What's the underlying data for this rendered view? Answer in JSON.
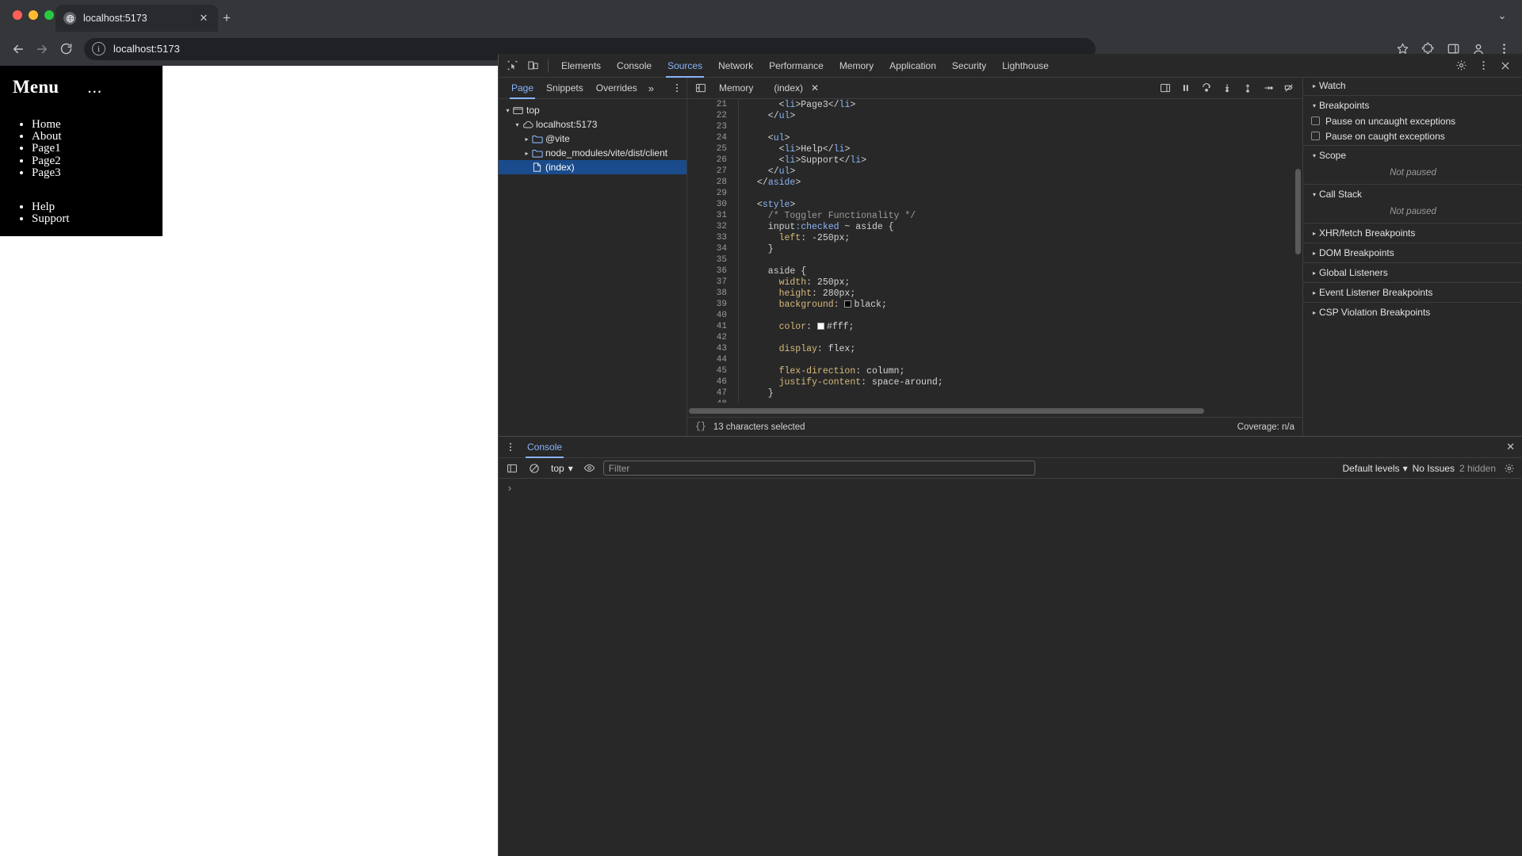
{
  "browser": {
    "tab": {
      "title": "localhost:5173",
      "favicon_icon": "globe-icon",
      "close_icon": "close-icon"
    },
    "new_tab_label": "+",
    "tabstrip_chevron_icon": "chevron-down-icon",
    "nav": {
      "back_icon": "arrow-left-icon",
      "forward_icon": "arrow-right-icon",
      "reload_icon": "reload-icon"
    },
    "omnibox": {
      "info_icon": "info-circle-icon",
      "url": "localhost:5173"
    },
    "actions": {
      "bookmark_icon": "star-icon",
      "extensions_icon": "puzzle-icon",
      "split_icon": "sidebar-icon",
      "profile_icon": "person-icon",
      "menu_icon": "kebab-menu-icon"
    }
  },
  "page": {
    "aside": {
      "title": "Menu",
      "toggle_label": "...",
      "primary_items": [
        "Home",
        "About",
        "Page1",
        "Page2",
        "Page3"
      ],
      "secondary_items": [
        "Help",
        "Support"
      ],
      "background": "#000000",
      "color": "#ffffff"
    }
  },
  "devtools": {
    "toolbar": {
      "inspect_icon": "inspect-element-icon",
      "device_icon": "device-toolbar-icon",
      "tabs": [
        {
          "label": "Elements",
          "active": false
        },
        {
          "label": "Console",
          "active": false
        },
        {
          "label": "Sources",
          "active": true
        },
        {
          "label": "Network",
          "active": false
        },
        {
          "label": "Performance",
          "active": false
        },
        {
          "label": "Memory",
          "active": false
        },
        {
          "label": "Application",
          "active": false
        },
        {
          "label": "Security",
          "active": false
        },
        {
          "label": "Lighthouse",
          "active": false
        }
      ],
      "settings_icon": "gear-icon",
      "more_icon": "kebab-menu-icon",
      "close_icon": "close-icon"
    },
    "navigator": {
      "tabs": [
        {
          "label": "Page",
          "active": true
        },
        {
          "label": "Snippets",
          "active": false
        },
        {
          "label": "Overrides",
          "active": false
        }
      ],
      "more_label": "»",
      "menu_icon": "kebab-menu-icon",
      "tree": [
        {
          "label": "top",
          "icon": "frame-icon",
          "depth": 0,
          "twisty": "▾",
          "selected": false
        },
        {
          "label": "localhost:5173",
          "icon": "cloud-icon",
          "depth": 1,
          "twisty": "▾",
          "selected": false
        },
        {
          "label": "@vite",
          "icon": "folder-icon",
          "depth": 2,
          "twisty": "▸",
          "selected": false
        },
        {
          "label": "node_modules/vite/dist/client",
          "icon": "folder-icon",
          "depth": 2,
          "twisty": "▸",
          "selected": false
        },
        {
          "label": "(index)",
          "icon": "document-icon",
          "depth": 2,
          "twisty": "",
          "selected": true
        }
      ]
    },
    "editor": {
      "sidebar_toggle_icon": "panel-left-icon",
      "memory_tab": "Memory",
      "file_tab": "(index)",
      "file_close_icon": "close-icon",
      "status_left": "13 characters selected",
      "status_right": "Coverage: n/a",
      "brace_icon": "{}",
      "lines": [
        {
          "n": "21",
          "segments": [
            {
              "t": "    <",
              "c": "punc"
            },
            {
              "t": "li",
              "c": "tag"
            },
            {
              "t": ">Page3</",
              "c": "punc"
            },
            {
              "t": "li",
              "c": "tag"
            },
            {
              "t": ">",
              "c": "punc"
            }
          ]
        },
        {
          "n": "22",
          "segments": [
            {
              "t": "  </",
              "c": "punc"
            },
            {
              "t": "ul",
              "c": "tag"
            },
            {
              "t": ">",
              "c": "punc"
            }
          ]
        },
        {
          "n": "23",
          "segments": []
        },
        {
          "n": "24",
          "segments": [
            {
              "t": "  <",
              "c": "punc"
            },
            {
              "t": "ul",
              "c": "tag"
            },
            {
              "t": ">",
              "c": "punc"
            }
          ]
        },
        {
          "n": "25",
          "segments": [
            {
              "t": "    <",
              "c": "punc"
            },
            {
              "t": "li",
              "c": "tag"
            },
            {
              "t": ">Help</",
              "c": "punc"
            },
            {
              "t": "li",
              "c": "tag"
            },
            {
              "t": ">",
              "c": "punc"
            }
          ]
        },
        {
          "n": "26",
          "segments": [
            {
              "t": "    <",
              "c": "punc"
            },
            {
              "t": "li",
              "c": "tag"
            },
            {
              "t": ">Support</",
              "c": "punc"
            },
            {
              "t": "li",
              "c": "tag"
            },
            {
              "t": ">",
              "c": "punc"
            }
          ]
        },
        {
          "n": "27",
          "segments": [
            {
              "t": "  </",
              "c": "punc"
            },
            {
              "t": "ul",
              "c": "tag"
            },
            {
              "t": ">",
              "c": "punc"
            }
          ]
        },
        {
          "n": "28",
          "segments": [
            {
              "t": "</",
              "c": "punc"
            },
            {
              "t": "aside",
              "c": "tag"
            },
            {
              "t": ">",
              "c": "punc"
            }
          ]
        },
        {
          "n": "29",
          "segments": []
        },
        {
          "n": "30",
          "segments": [
            {
              "t": "<",
              "c": "punc"
            },
            {
              "t": "style",
              "c": "tag"
            },
            {
              "t": ">",
              "c": "punc"
            }
          ]
        },
        {
          "n": "31",
          "segments": [
            {
              "t": "  /* Toggler Functionality */",
              "c": "cmt"
            }
          ]
        },
        {
          "n": "32",
          "segments": [
            {
              "t": "  input",
              "c": "sel"
            },
            {
              "t": ":checked",
              "c": "pseudo"
            },
            {
              "t": " ~ ",
              "c": "val"
            },
            {
              "t": "aside",
              "c": "sel"
            },
            {
              "t": " {",
              "c": "val"
            }
          ]
        },
        {
          "n": "33",
          "segments": [
            {
              "t": "    left",
              "c": "prop"
            },
            {
              "t": ": -250px;",
              "c": "val"
            }
          ]
        },
        {
          "n": "34",
          "segments": [
            {
              "t": "  }",
              "c": "val"
            }
          ]
        },
        {
          "n": "35",
          "segments": []
        },
        {
          "n": "36",
          "segments": [
            {
              "t": "  aside",
              "c": "sel"
            },
            {
              "t": " {",
              "c": "val"
            }
          ]
        },
        {
          "n": "37",
          "segments": [
            {
              "t": "    width",
              "c": "prop"
            },
            {
              "t": ": 250px;",
              "c": "val"
            }
          ]
        },
        {
          "n": "38",
          "segments": [
            {
              "t": "    height",
              "c": "prop"
            },
            {
              "t": ": 280px;",
              "c": "val"
            }
          ]
        },
        {
          "n": "39",
          "segments": [
            {
              "t": "    background",
              "c": "prop"
            },
            {
              "t": ": ",
              "c": "val"
            },
            {
              "t": "@sw-black@black;",
              "c": "val"
            }
          ]
        },
        {
          "n": "40",
          "segments": []
        },
        {
          "n": "41",
          "segments": [
            {
              "t": "    color",
              "c": "prop"
            },
            {
              "t": ": ",
              "c": "val"
            },
            {
              "t": "@sw-white@#fff;",
              "c": "val"
            }
          ]
        },
        {
          "n": "42",
          "segments": []
        },
        {
          "n": "43",
          "segments": [
            {
              "t": "    display",
              "c": "prop"
            },
            {
              "t": ": flex;",
              "c": "val"
            }
          ]
        },
        {
          "n": "44",
          "segments": []
        },
        {
          "n": "45",
          "segments": [
            {
              "t": "    flex-direction",
              "c": "prop"
            },
            {
              "t": ": column;",
              "c": "val"
            }
          ]
        },
        {
          "n": "46",
          "segments": [
            {
              "t": "    justify-content",
              "c": "prop"
            },
            {
              "t": ": space-around;",
              "c": "val"
            }
          ]
        },
        {
          "n": "47",
          "segments": [
            {
              "t": "  }",
              "c": "val"
            }
          ]
        },
        {
          "n": "48",
          "segments": []
        }
      ],
      "debug_controls": [
        "pause-resume-icon",
        "step-over-icon",
        "step-into-icon",
        "step-out-icon",
        "step-icon",
        "deactivate-breakpoints-icon"
      ]
    },
    "debugger": {
      "sections": [
        {
          "label": "Watch",
          "caret": "▸",
          "expanded": false
        },
        {
          "label": "Breakpoints",
          "caret": "▾",
          "expanded": true
        },
        {
          "label": "Scope",
          "caret": "▾",
          "expanded": true
        },
        {
          "label": "Call Stack",
          "caret": "▾",
          "expanded": true
        },
        {
          "label": "XHR/fetch Breakpoints",
          "caret": "▸",
          "expanded": false
        },
        {
          "label": "DOM Breakpoints",
          "caret": "▸",
          "expanded": false
        },
        {
          "label": "Global Listeners",
          "caret": "▸",
          "expanded": false
        },
        {
          "label": "Event Listener Breakpoints",
          "caret": "▸",
          "expanded": false
        },
        {
          "label": "CSP Violation Breakpoints",
          "caret": "▸",
          "expanded": false
        }
      ],
      "breakpoint_options": [
        {
          "label": "Pause on uncaught exceptions",
          "checked": false
        },
        {
          "label": "Pause on caught exceptions",
          "checked": false
        }
      ],
      "scope_empty": "Not paused",
      "callstack_empty": "Not paused"
    },
    "console": {
      "menu_icon": "kebab-menu-icon",
      "tab_label": "Console",
      "close_icon": "close-icon",
      "sidebar_icon": "console-sidebar-icon",
      "clear_icon": "clear-console-icon",
      "context": "top",
      "context_caret": "▾",
      "eye_icon": "live-expression-icon",
      "filter_placeholder": "Filter",
      "filter_value": "",
      "levels_label": "Default levels",
      "levels_caret": "▾",
      "issues_label": "No Issues",
      "hidden_label": "2 hidden",
      "settings_icon": "gear-icon",
      "prompt": "›"
    }
  },
  "colors": {
    "accent": "#8ab4f8",
    "panel_bg": "#282828",
    "selected_row": "#1a4b8c",
    "chrome_bg": "#35363a"
  }
}
